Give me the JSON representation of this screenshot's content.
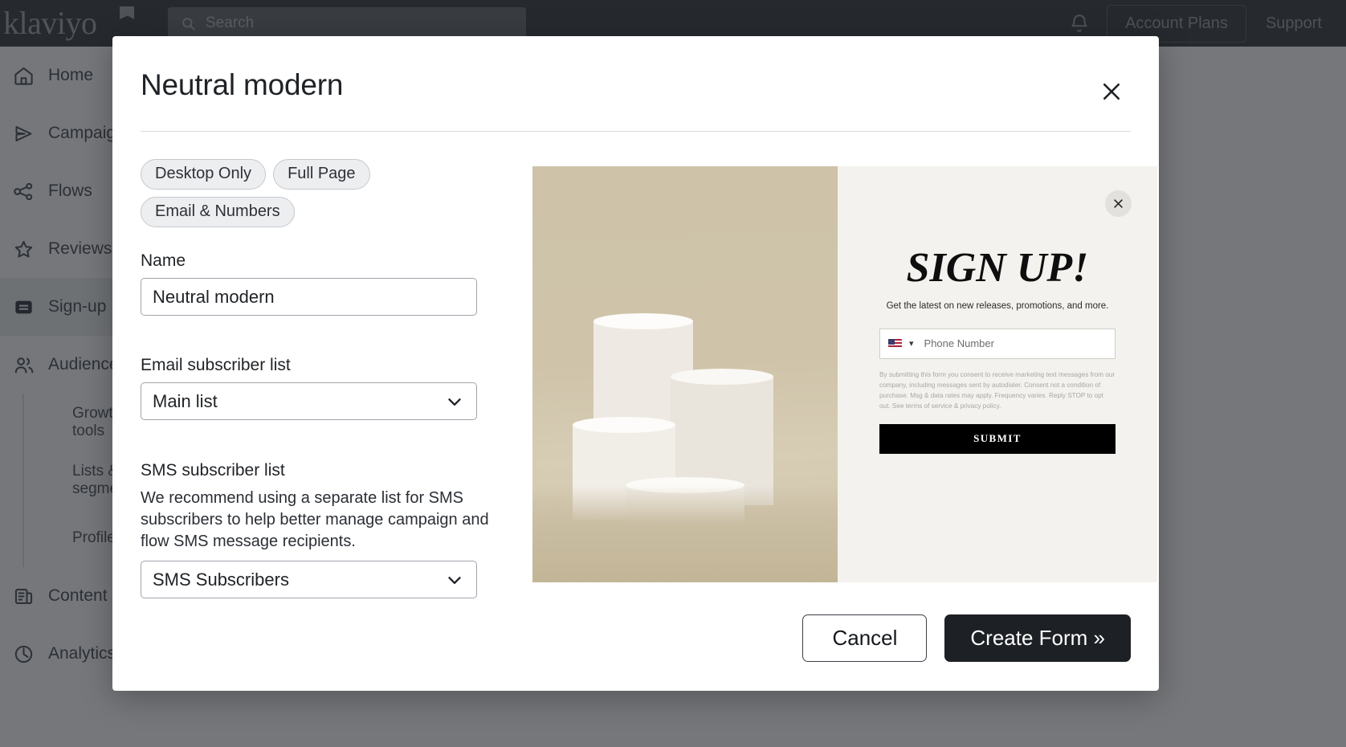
{
  "topnav": {
    "logo_text": "klaviyo",
    "search_placeholder": "Search",
    "search_value": "",
    "account_plans_label": "Account Plans",
    "support_label": "Support"
  },
  "sidebar": {
    "items": [
      {
        "label": "Home",
        "icon": "home-icon"
      },
      {
        "label": "Campaigns",
        "icon": "send-icon"
      },
      {
        "label": "Flows",
        "icon": "flows-icon"
      },
      {
        "label": "Reviews",
        "icon": "star-icon"
      },
      {
        "label": "Sign-up",
        "icon": "signup-form-icon"
      },
      {
        "label": "Audience",
        "icon": "people-icon"
      }
    ],
    "sub_items": [
      {
        "label": "Growth tools"
      },
      {
        "label": "Lists & segments"
      },
      {
        "label": "Profiles"
      }
    ],
    "items_after": [
      {
        "label": "Content",
        "icon": "content-icon"
      },
      {
        "label": "Analytics",
        "icon": "analytics-icon"
      }
    ]
  },
  "modal": {
    "title": "Neutral modern",
    "close_label": "✕",
    "tags": [
      "Desktop Only",
      "Full Page",
      "Email & Numbers"
    ],
    "name_label": "Name",
    "name_value": "Neutral modern",
    "email_list_label": "Email subscriber list",
    "email_list_value": "Main list",
    "sms_list_label": "SMS subscriber list",
    "sms_list_help": "We recommend using a separate list for SMS subscribers to help better manage campaign and flow SMS message recipients.",
    "sms_list_value": "SMS Subscribers",
    "cancel_label": "Cancel",
    "create_label": "Create Form »"
  },
  "preview": {
    "close_label": "✕",
    "headline": "SIGN UP!",
    "subhead": "Get the latest on new releases, promotions, and more.",
    "phone_placeholder": "Phone Number",
    "country_flag": "us-flag-icon",
    "consent_text": "By submitting this form you consent to receive marketing text messages from our company, including messages sent by autodialer. Consent not a condition of purchase. Msg & data rates may apply. Frequency varies. Reply STOP to opt out. See terms of service & privacy policy.",
    "submit_label": "SUBMIT"
  },
  "colors": {
    "topnav_bg": "#31353c",
    "accent_dark": "#1d2024",
    "tag_bg": "#edeef0",
    "preview_bg": "#f4f2ee",
    "photo_bg": "#cec3a9"
  }
}
